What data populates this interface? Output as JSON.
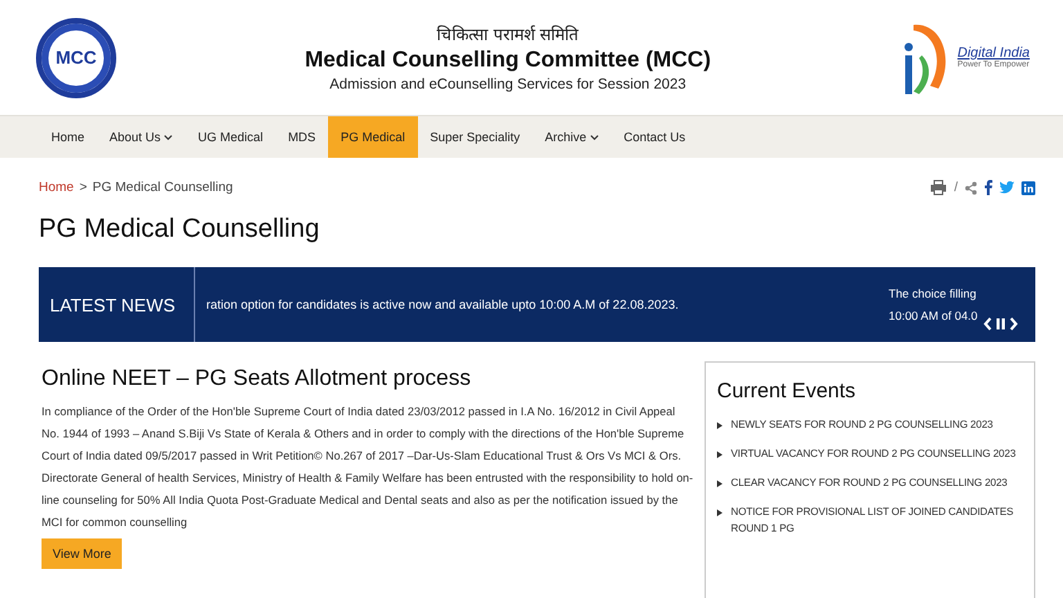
{
  "header": {
    "logo_text": "MCC",
    "hindi_title": "चिकित्सा परामर्श समिति",
    "title": "Medical Counselling Committee (MCC)",
    "subtitle": "Admission and eCounselling Services for Session 2023",
    "partner_logo": {
      "name": "Digital India",
      "tagline": "Power To Empower"
    }
  },
  "nav": [
    {
      "label": "Home",
      "selected": false,
      "dropdown": false
    },
    {
      "label": "About Us",
      "selected": false,
      "dropdown": true
    },
    {
      "label": "UG Medical",
      "selected": false,
      "dropdown": false
    },
    {
      "label": "MDS",
      "selected": false,
      "dropdown": false
    },
    {
      "label": "PG Medical",
      "selected": true,
      "dropdown": false
    },
    {
      "label": "Super Speciality",
      "selected": false,
      "dropdown": false
    },
    {
      "label": "Archive",
      "selected": false,
      "dropdown": true
    },
    {
      "label": "Contact Us",
      "selected": false,
      "dropdown": false
    }
  ],
  "breadcrumb": [
    "Home",
    "PG Medical Counselling"
  ],
  "breadcrumb_separator": ">",
  "share_separator": "/",
  "page_title": "PG Medical Counselling",
  "latest_news": {
    "label": "LATEST NEWS",
    "ticker": "ration option for candidates is active now and available upto 10:00 A.M of 22.08.2023.",
    "next_item": [
      "The choice filling",
      "10:00 AM of 04.0"
    ]
  },
  "article": {
    "title": "Online NEET – PG Seats Allotment process",
    "body": "In compliance of the Order of the Hon'ble Supreme Court of India dated 23/03/2012 passed in I.A No. 16/2012 in Civil Appeal No. 1944 of 1993 – Anand S.Biji Vs State of Kerala & Others and in order to comply with the directions of the Hon'ble Supreme Court of India dated 09/5/2017 passed in Writ Petition© No.267 of 2017 –Dar-Us-Slam Educational Trust & Ors Vs MCI & Ors. Directorate General of health Services, Ministry of Health & Family Welfare has been entrusted with the responsibility to hold on-line counseling for 50% All India Quota Post-Graduate Medical and Dental seats and also as per the notification issued by the MCI for common counselling",
    "button": "View More"
  },
  "current_events": {
    "title": "Current Events",
    "items": [
      "NEWLY SEATS FOR ROUND 2 PG COUNSELLING 2023",
      "VIRTUAL VACANCY FOR ROUND 2 PG COUNSELLING 2023",
      "CLEAR VACANCY FOR ROUND 2 PG COUNSELLING 2023",
      "NOTICE FOR PROVISIONAL LIST OF JOINED CANDIDATES ROUND 1 PG"
    ]
  }
}
